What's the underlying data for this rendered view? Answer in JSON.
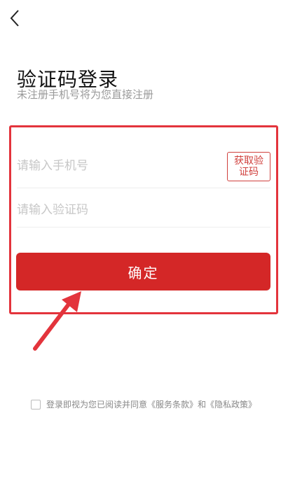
{
  "header": {
    "back_icon": "chevron-left-icon"
  },
  "title": "验证码登录",
  "subtitle": "未注册手机号将为您直接注册",
  "form": {
    "phone_placeholder": "请输入手机号",
    "get_code_label": "获取验证码",
    "code_placeholder": "请输入验证码",
    "confirm_label": "确定"
  },
  "agreement": {
    "text": "登录即视为您已阅读并同意《服务条款》和《隐私政策》"
  },
  "colors": {
    "accent": "#d42727",
    "highlight": "#e3343c",
    "placeholder": "#c7c7c7"
  }
}
